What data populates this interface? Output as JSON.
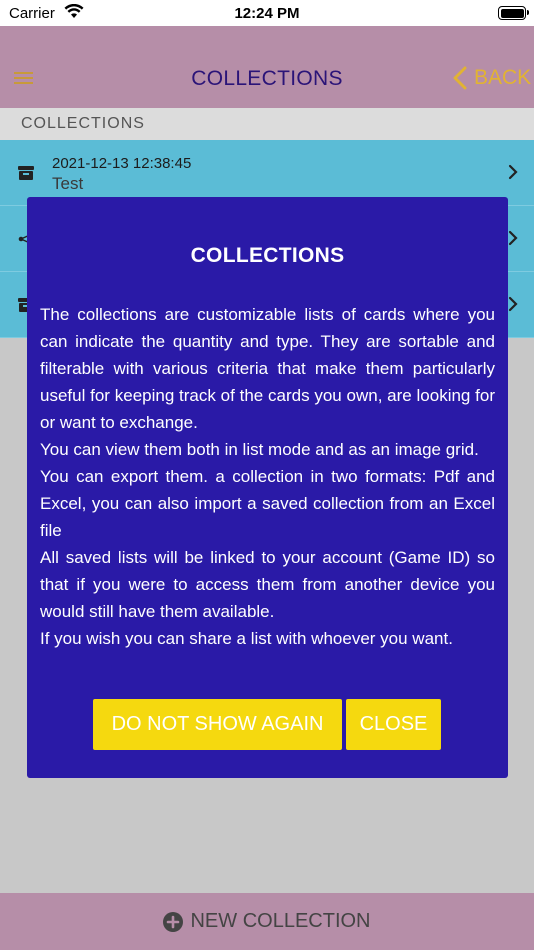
{
  "status_bar": {
    "carrier": "Carrier",
    "time": "12:24 PM"
  },
  "navbar": {
    "title": "COLLECTIONS",
    "back_label": "BACK",
    "accent_color": "#e2b332",
    "title_color": "#2b1478",
    "background": "#b68ea8"
  },
  "section": {
    "header": "COLLECTIONS"
  },
  "rows": [
    {
      "date": "2021-12-13 12:38:45",
      "name": "Test",
      "icon": "archive-icon"
    },
    {
      "date": "",
      "name": "",
      "icon": "share-icon"
    },
    {
      "date": "",
      "name": "",
      "icon": "archive-icon"
    }
  ],
  "dialog": {
    "title": "COLLECTIONS",
    "paragraphs": [
      "The collections are customizable lists of cards where you can indicate the quantity and type. They are sortable and filterable with various criteria that make them particularly useful for keeping track of the cards you own, are looking for or want to exchange.",
      "You can view them both in list mode and as an image grid.",
      "You can export them. a collection in two formats: Pdf and Excel, you can also import a saved collection from an Excel file",
      "All saved lists will be linked to your account (Game ID) so that if you were to access them from another device you would still have them available.",
      "If you wish you can share a list with whoever you want."
    ],
    "do_not_show_label": "DO NOT SHOW AGAIN",
    "close_label": "CLOSE",
    "background": "#2a1aa7",
    "button_color": "#f5d90f"
  },
  "bottom_bar": {
    "label": "NEW COLLECTION"
  }
}
